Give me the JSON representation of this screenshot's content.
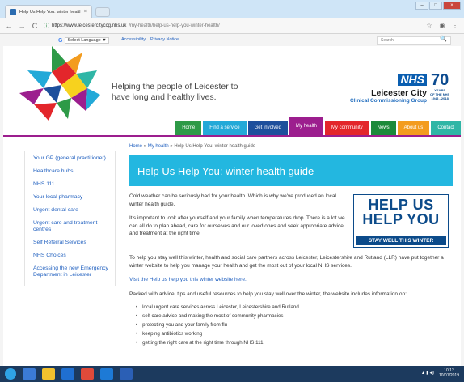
{
  "browser": {
    "tab_title": "Help Us Help You: winter health",
    "tab_close": "×",
    "url_secure": "ⓘ",
    "url_host": "https://www.leicestercityccg.nhs.uk",
    "url_path": "/my-health/help-us-help-you-winter-health/",
    "back": "←",
    "forward": "→",
    "reload": "C",
    "star": "☆",
    "account": "◉",
    "menu": "⋮",
    "minimize": "–",
    "maximize": "□",
    "close": "×"
  },
  "topbar": {
    "lang_label": "Select Language",
    "lang_arrow": "▼",
    "links": [
      "Accessibility",
      "Privacy Notice"
    ],
    "search_placeholder": "Search",
    "search_icon": "🔍"
  },
  "header": {
    "tagline": "Helping the people of Leicester to have long and healthy lives.",
    "nhs": "NHS",
    "org_name": "Leicester City",
    "org_sub": "Clinical Commissioning Group",
    "seventy": "70",
    "seventy_sub1": "YEARS",
    "seventy_sub2": "OF THE NHS",
    "seventy_sub3": "1948 - 2018"
  },
  "nav": [
    {
      "label": "Home",
      "color": "#2e9a47"
    },
    {
      "label": "Find a service",
      "color": "#23a9d8"
    },
    {
      "label": "Get involved",
      "color": "#1e4f9c"
    },
    {
      "label": "My health",
      "color": "#9c1e8e",
      "active": true
    },
    {
      "label": "My community",
      "color": "#e3262b"
    },
    {
      "label": "News",
      "color": "#1c8a3a"
    },
    {
      "label": "About us",
      "color": "#f39c1f"
    },
    {
      "label": "Contact",
      "color": "#2fb6a6"
    }
  ],
  "sidebar": [
    "Your GP (general practitioner)",
    "Healthcare hubs",
    "NHS 111",
    "Your local pharmacy",
    "Urgent dental care",
    "Urgent care and treatment centres",
    "Self Referral Services",
    "NHS Choices",
    "Accessing the new Emergency Department in Leicester"
  ],
  "breadcrumb": {
    "home": "Home",
    "sep": "»",
    "section": "My health",
    "current": "Help Us Help You: winter health guide"
  },
  "title": "Help Us Help You: winter health guide",
  "paragraphs": {
    "p1": "Cold weather can be seriously bad for your health. Which is why we've produced an local winter health guide.",
    "p2": "It's important to look after yourself and your family when temperatures drop. There is a lot we can all do to plan ahead, care for ourselves and our loved ones and seek appropriate advice and treatment at the right time.",
    "p3": "To help you stay well this winter, health and social care partners across Leicester, Leicestershire and Rutland (LLR) have put together a winter website to help you manage your health and get the most out of your local NHS services.",
    "link": "Visit the Help us help you this winter website here.",
    "p4": "Packed with advice, tips and useful resources to help you stay well over the winter, the website includes information on:"
  },
  "badge": {
    "line1": "HELP US",
    "line2": "HELP YOU",
    "line3": "STAY WELL THIS WINTER"
  },
  "bullets": [
    "local urgent care services across Leicester, Leicestershire and Rutland",
    "self care advice and making the most of community pharmacies",
    "protecting you and your family from flu",
    "keeping antibiotics working",
    "getting the right care at the right time through NHS 111"
  ],
  "bullet_char": "•",
  "taskbar": {
    "time": "10:12",
    "date": "10/01/2019",
    "apps": [
      "#3b7bd6",
      "#f2c12e",
      "#1f6fd1",
      "#e04a3a",
      "#1d7ad6",
      "#2b5fb5"
    ]
  }
}
